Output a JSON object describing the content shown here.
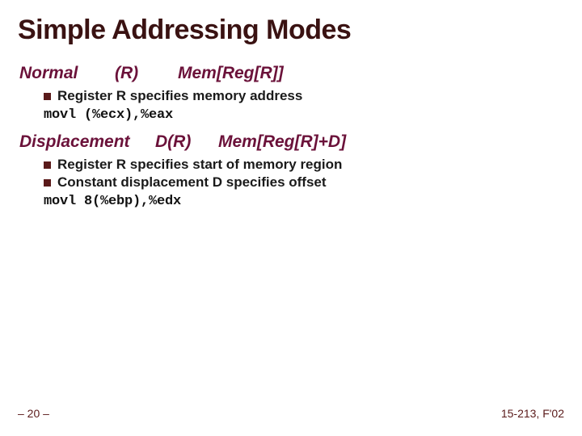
{
  "title": "Simple Addressing Modes",
  "sections": [
    {
      "label": "Normal",
      "syntax": "(R)",
      "semantics": "Mem[Reg[R]]",
      "bullets": [
        "Register R specifies memory address"
      ],
      "code": "movl (%ecx),%eax"
    },
    {
      "label": "Displacement",
      "syntax": "D(R)",
      "semantics": "Mem[Reg[R]+D]",
      "bullets": [
        "Register R specifies start of memory region",
        "Constant displacement D specifies offset"
      ],
      "code": "movl 8(%ebp),%edx"
    }
  ],
  "footer": {
    "left": "– 20 –",
    "right": "15-213, F'02"
  }
}
